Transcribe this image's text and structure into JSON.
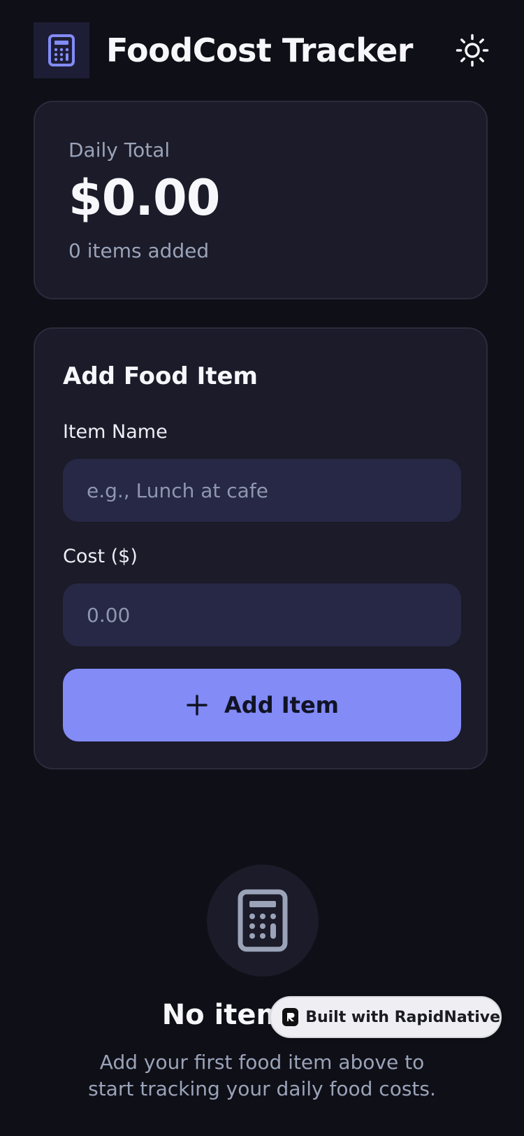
{
  "colors": {
    "background": "#0f0f17",
    "card": "#1b1b29",
    "input": "#272845",
    "accent": "#828bf6",
    "muted_text": "#9aa3b8"
  },
  "header": {
    "logo_icon": "calculator-icon",
    "title": "FoodCost Tracker",
    "theme_icon": "sun-icon"
  },
  "summary": {
    "label": "Daily Total",
    "total": "$0.00",
    "count_text": "0 items added"
  },
  "form": {
    "title": "Add Food Item",
    "name_label": "Item Name",
    "name_placeholder": "e.g., Lunch at cafe",
    "name_value": "",
    "cost_label": "Cost ($)",
    "cost_placeholder": "0.00",
    "cost_value": "",
    "add_icon": "plus-icon",
    "add_label": "Add Item"
  },
  "empty_state": {
    "icon": "calculator-icon",
    "title": "No items yet",
    "subtitle": "Add your first food item above to start tracking your daily food costs."
  },
  "badge": {
    "icon": "rapidnative-logo-icon",
    "label": "Built with RapidNative"
  }
}
